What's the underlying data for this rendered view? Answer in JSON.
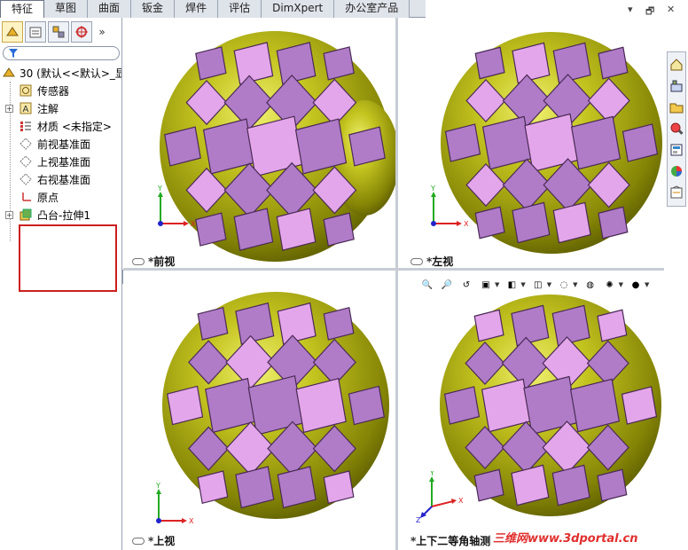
{
  "tabs": [
    "特征",
    "草图",
    "曲面",
    "钣金",
    "焊件",
    "评估",
    "DimXpert",
    "办公室产品"
  ],
  "active_tab": "特征",
  "feature_tree": {
    "root": "30 (默认<<默认>_显",
    "items": [
      {
        "label": "传感器",
        "icon": "sensor-icon",
        "expandable": false
      },
      {
        "label": "注解",
        "icon": "annotation-icon",
        "expandable": true
      },
      {
        "label": "材质 <未指定>",
        "icon": "material-icon",
        "expandable": false
      },
      {
        "label": "前视基准面",
        "icon": "plane-icon",
        "expandable": false
      },
      {
        "label": "上视基准面",
        "icon": "plane-icon",
        "expandable": false
      },
      {
        "label": "右视基准面",
        "icon": "plane-icon",
        "expandable": false
      },
      {
        "label": "原点",
        "icon": "origin-icon",
        "expandable": false
      },
      {
        "label": "凸台-拉伸1",
        "icon": "extrude-icon",
        "expandable": true
      }
    ]
  },
  "viewports": {
    "front": "*前视",
    "left": "*左视",
    "top": "*上视",
    "iso": "*上下二等角轴测"
  },
  "triad_axes": {
    "x": "X",
    "y": "Y",
    "z": "Z"
  },
  "watermark": "三维网www.3dportal.cn",
  "colors": {
    "sphere": "#9a9a10",
    "window": "#b07cc8",
    "x_axis": "#d22",
    "y_axis": "#2a2",
    "z_axis": "#22c"
  }
}
